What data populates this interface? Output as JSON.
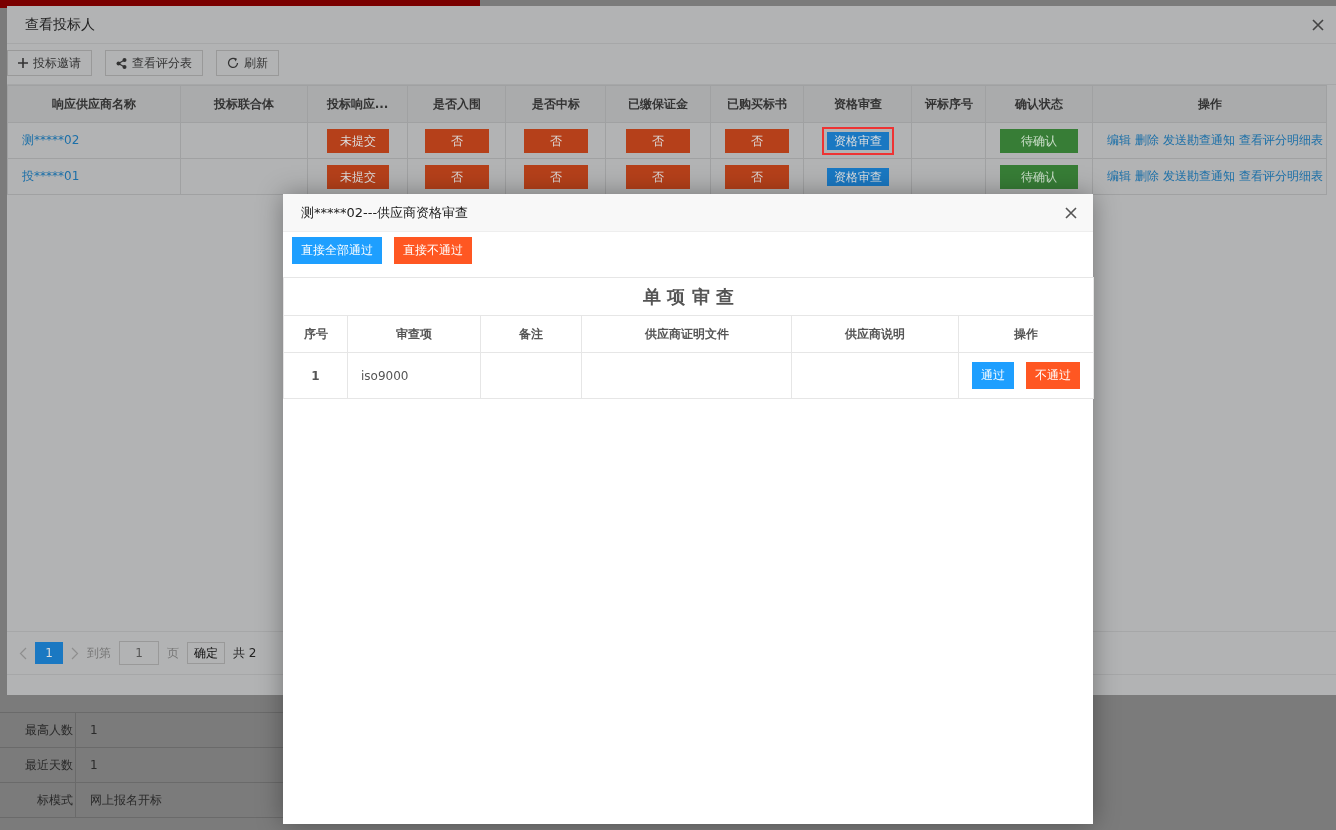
{
  "background": {
    "rows": [
      {
        "label": "最高人数",
        "value": "1"
      },
      {
        "label": "最近天数",
        "value": "1"
      },
      {
        "label": "标模式",
        "value": "网上报名开标"
      }
    ]
  },
  "dialog": {
    "title": "查看投标人",
    "toolbar": [
      {
        "kind": "add",
        "label": "投标邀请"
      },
      {
        "kind": "share",
        "label": "查看评分表"
      },
      {
        "kind": "refresh",
        "label": "刷新"
      }
    ],
    "table": {
      "columns": [
        "响应供应商名称",
        "投标联合体",
        "投标响应...",
        "是否入围",
        "是否中标",
        "已缴保证金",
        "已购买标书",
        "资格审查",
        "评标序号",
        "确认状态",
        "操作"
      ],
      "rows": [
        {
          "name": "测*****02",
          "response": "未提交",
          "shortlisted": "否",
          "won": "否",
          "deposit": "否",
          "bought": "否",
          "review": "资格审查",
          "highlighted": true,
          "confirm": "待确认",
          "actions": [
            "编辑",
            "删除",
            "发送勘查通知",
            "查看评分明细表"
          ]
        },
        {
          "name": "投*****01",
          "response": "未提交",
          "shortlisted": "否",
          "won": "否",
          "deposit": "否",
          "bought": "否",
          "review": "资格审查",
          "highlighted": false,
          "confirm": "待确认",
          "actions": [
            "编辑",
            "删除",
            "发送勘查通知",
            "查看评分明细表"
          ]
        }
      ]
    },
    "pagination": {
      "pages": [
        {
          "label": "1",
          "selected": true
        }
      ],
      "goto": "到第",
      "page_value": "1",
      "page_unit": "页",
      "confirm": "确定",
      "total": "共 2"
    }
  },
  "modal": {
    "title": "测*****02---供应商资格审查",
    "buttons": [
      {
        "kind": "primary",
        "label": "直接全部通过"
      },
      {
        "kind": "danger",
        "label": "直接不通过"
      }
    ],
    "section_title": "单 项 审 查",
    "columns": [
      "序号",
      "审查项",
      "备注",
      "供应商证明文件",
      "供应商说明",
      "操作"
    ],
    "rows": [
      {
        "no": "1",
        "item": "iso9000",
        "actions": [
          {
            "kind": "primary",
            "label": "通过"
          },
          {
            "kind": "danger",
            "label": "不通过"
          }
        ]
      }
    ]
  }
}
